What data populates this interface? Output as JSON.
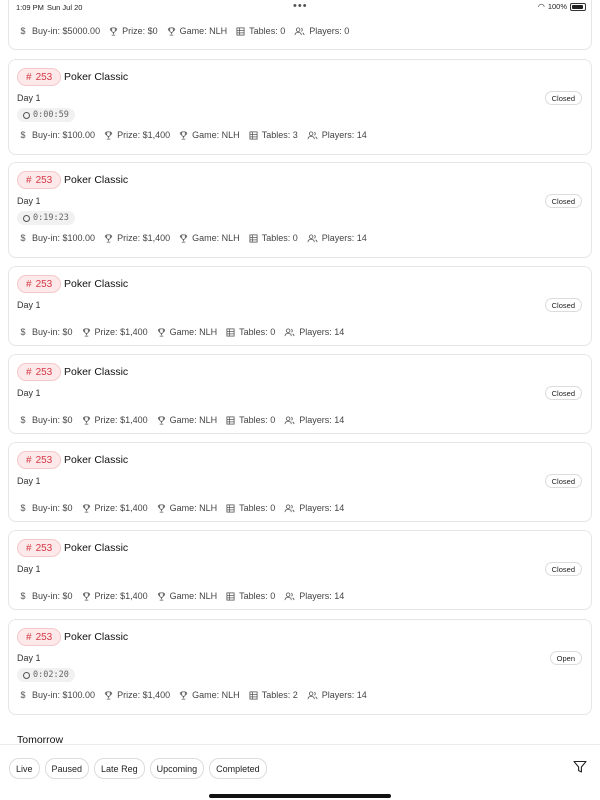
{
  "status_bar": {
    "time": "1:09 PM",
    "date": "Sun Jul 20",
    "battery": "100%"
  },
  "labels": {
    "buyin": "Buy-in:",
    "prize": "Prize:",
    "game": "Game:",
    "tables": "Tables:",
    "players": "Players:"
  },
  "top_partial": {
    "buyin": "$5000.00",
    "prize": "$0",
    "game": "NLH",
    "tables": "0",
    "players": "0"
  },
  "tournaments": [
    {
      "number": "253",
      "name": "Poker Classic",
      "day": "Day 1",
      "status": "Closed",
      "timer": "0:00:59",
      "buyin": "$100.00",
      "prize": "$1,400",
      "game": "NLH",
      "tables": "3",
      "players": "14"
    },
    {
      "number": "253",
      "name": "Poker Classic",
      "day": "Day 1",
      "status": "Closed",
      "timer": "0:19:23",
      "buyin": "$100.00",
      "prize": "$1,400",
      "game": "NLH",
      "tables": "0",
      "players": "14"
    },
    {
      "number": "253",
      "name": "Poker Classic",
      "day": "Day 1",
      "status": "Closed",
      "timer": "",
      "buyin": "$0",
      "prize": "$1,400",
      "game": "NLH",
      "tables": "0",
      "players": "14"
    },
    {
      "number": "253",
      "name": "Poker Classic",
      "day": "Day 1",
      "status": "Closed",
      "timer": "",
      "buyin": "$0",
      "prize": "$1,400",
      "game": "NLH",
      "tables": "0",
      "players": "14"
    },
    {
      "number": "253",
      "name": "Poker Classic",
      "day": "Day 1",
      "status": "Closed",
      "timer": "",
      "buyin": "$0",
      "prize": "$1,400",
      "game": "NLH",
      "tables": "0",
      "players": "14"
    },
    {
      "number": "253",
      "name": "Poker Classic",
      "day": "Day 1",
      "status": "Closed",
      "timer": "",
      "buyin": "$0",
      "prize": "$1,400",
      "game": "NLH",
      "tables": "0",
      "players": "14"
    },
    {
      "number": "253",
      "name": "Poker Classic",
      "day": "Day 1",
      "status": "Open",
      "timer": "0:02:20",
      "buyin": "$100.00",
      "prize": "$1,400",
      "game": "NLH",
      "tables": "2",
      "players": "14"
    }
  ],
  "section_title": "Tomorrow",
  "filters": [
    "Live",
    "Paused",
    "Late Reg",
    "Upcoming",
    "Completed"
  ],
  "icons": {
    "tag": "hash-icon",
    "filter": "filter-funnel-icon"
  },
  "colors": {
    "tag_text": "#d33a44",
    "tag_bg": "#fde9ea"
  }
}
